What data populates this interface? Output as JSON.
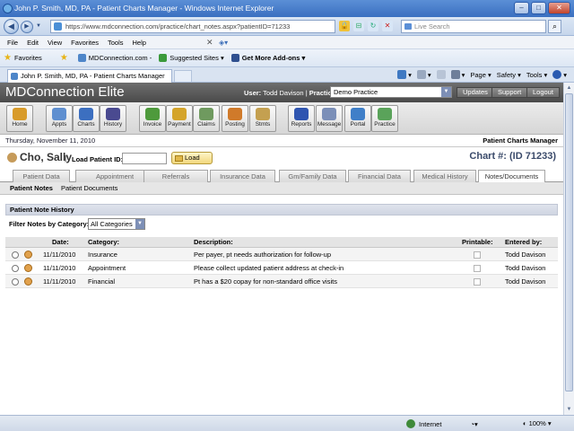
{
  "window": {
    "title": "John P. Smith, MD, PA - Patient Charts Manager - Windows Internet Explorer",
    "min": "–",
    "max": "□",
    "close": "✕"
  },
  "browser": {
    "url": "https://www.mdconnection.com/practice/chart_notes.aspx?patientID=71233",
    "search_placeholder": "Live Search",
    "menu": [
      "File",
      "Edit",
      "View",
      "Favorites",
      "Tools",
      "Help"
    ],
    "favorites_label": "Favorites",
    "fav_items": [
      "MDConnection.com -",
      "Suggested Sites ▾",
      "Get More Add-ons ▾"
    ],
    "tab_title": "John P. Smith, MD, PA - Patient Charts Manager",
    "cmd": [
      "Page ▾",
      "Safety ▾",
      "Tools ▾"
    ]
  },
  "app": {
    "title": "MDConnection Elite",
    "user_label": "User:",
    "user_name": "Todd Davison",
    "practice_label": "Practice:",
    "practice_value": "Demo Practice",
    "header_buttons": [
      "Updates",
      "Support",
      "Logout"
    ],
    "toolbar": [
      {
        "label": "Home",
        "icon": "caduceus-icon",
        "color": "#d89b2a"
      },
      {
        "label": "Appts",
        "icon": "calendar-icon",
        "color": "#5f8fd0"
      },
      {
        "label": "Charts",
        "icon": "chart-icon",
        "color": "#3c6fc0"
      },
      {
        "label": "History",
        "icon": "clock-icon",
        "color": "#4a4a90"
      },
      {
        "label": "Invoice",
        "icon": "invoice-icon",
        "color": "#4e9a3c"
      },
      {
        "label": "Payment",
        "icon": "payment-icon",
        "color": "#d4a42a"
      },
      {
        "label": "Claims",
        "icon": "claims-icon",
        "color": "#6f9a5f"
      },
      {
        "label": "Posting",
        "icon": "posting-icon",
        "color": "#d07a2a"
      },
      {
        "label": "Stmts",
        "icon": "statements-icon",
        "color": "#c4a050"
      },
      {
        "label": "Reports",
        "icon": "reports-icon",
        "color": "#2f55b0"
      },
      {
        "label": "Message",
        "icon": "envelope-icon",
        "color": "#7b8fb8"
      },
      {
        "label": "Portal",
        "icon": "globe-icon",
        "color": "#3f7fc8"
      },
      {
        "label": "Practice",
        "icon": "doctor-icon",
        "color": "#5aa35a"
      }
    ],
    "date": "Thursday, November 11, 2010",
    "module": "Patient Charts Manager"
  },
  "patient": {
    "name": "Cho, Sally",
    "load_label": "Load Patient ID:",
    "patient_id_value": "",
    "load_button": "Load",
    "chart_no": "Chart #: (ID 71233)"
  },
  "tabs": [
    "Patient Data",
    "Appointment",
    "Referrals",
    "Insurance Data",
    "Gm/Family Data",
    "Financial Data",
    "Medical History",
    "Notes/Documents"
  ],
  "active_tab": "Notes/Documents",
  "subtabs": [
    "Patient Notes",
    "Patient Documents"
  ],
  "notes": {
    "section_title": "Patient Note History",
    "filter_label": "Filter Notes by Category:",
    "filter_value": "All Categories",
    "columns": [
      "Date:",
      "Category:",
      "Description:",
      "Printable:",
      "Entered by:"
    ],
    "rows": [
      {
        "date": "11/11/2010",
        "category": "Insurance",
        "description": "Per payer, pt needs authorization for follow-up",
        "printable": false,
        "entered_by": "Todd Davison"
      },
      {
        "date": "11/11/2010",
        "category": "Appointment",
        "description": "Please collect updated patient address at check-in",
        "printable": false,
        "entered_by": "Todd Davison"
      },
      {
        "date": "11/11/2010",
        "category": "Financial",
        "description": "Pt has a $20 copay for non-standard office visits",
        "printable": false,
        "entered_by": "Todd Davison"
      }
    ]
  },
  "status": {
    "zone": "Internet",
    "zoom": "100%"
  },
  "colors": {
    "titlebar": "#3a6fc0",
    "app_header": "#4a4a4a",
    "chart_no": "#3a4a6a"
  }
}
